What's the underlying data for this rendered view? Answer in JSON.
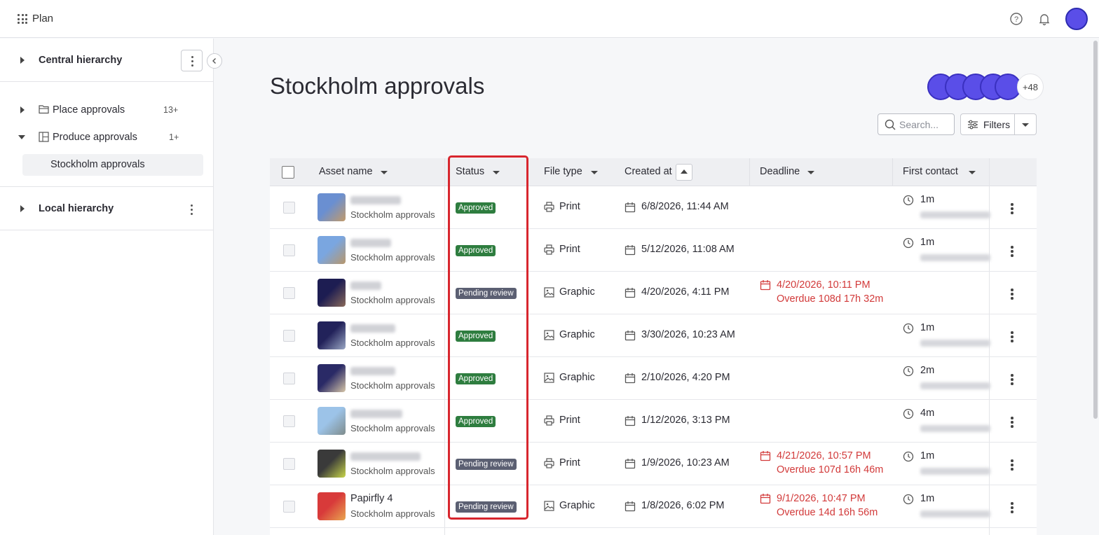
{
  "app": {
    "title": "Plan"
  },
  "sidebar": {
    "central": {
      "label": "Central hierarchy"
    },
    "place": {
      "label": "Place approvals",
      "count": "13+"
    },
    "produce": {
      "label": "Produce approvals",
      "count": "1+"
    },
    "selected": {
      "label": "Stockholm approvals"
    },
    "local": {
      "label": "Local hierarchy"
    }
  },
  "main": {
    "title": "Stockholm approvals",
    "avatars_more": "+48",
    "search_placeholder": "Search...",
    "filters_label": "Filters"
  },
  "table": {
    "headers": [
      "Asset name",
      "Status",
      "File type",
      "Created at",
      "Deadline",
      "First contact"
    ],
    "rows": [
      {
        "name": "",
        "sub": "Stockholm approvals",
        "status": "Approved",
        "status_kind": "approved",
        "filetype": "Print",
        "created": "6/8/2026, 11:44 AM",
        "deadline": "",
        "overdue": "",
        "first_contact": "1m",
        "thumb": [
          "#6a8fd1",
          "#c29a6a"
        ]
      },
      {
        "name": "",
        "sub": "Stockholm approvals",
        "status": "Approved",
        "status_kind": "approved",
        "filetype": "Print",
        "created": "5/12/2026, 11:08 AM",
        "deadline": "",
        "overdue": "",
        "first_contact": "1m",
        "thumb": [
          "#7aa6e0",
          "#b8976b"
        ]
      },
      {
        "name": "",
        "sub": "Stockholm approvals",
        "status": "Pending review",
        "status_kind": "pending",
        "filetype": "Graphic",
        "created": "4/20/2026, 4:11 PM",
        "deadline": "4/20/2026, 10:11 PM",
        "overdue": "Overdue 108d 17h 32m",
        "first_contact": "",
        "thumb": [
          "#1d1d52",
          "#8a6a5a"
        ]
      },
      {
        "name": "",
        "sub": "Stockholm approvals",
        "status": "Approved",
        "status_kind": "approved",
        "filetype": "Graphic",
        "created": "3/30/2026, 10:23 AM",
        "deadline": "",
        "overdue": "",
        "first_contact": "1m",
        "thumb": [
          "#22225a",
          "#9aa7c4"
        ]
      },
      {
        "name": "",
        "sub": "Stockholm approvals",
        "status": "Approved",
        "status_kind": "approved",
        "filetype": "Graphic",
        "created": "2/10/2026, 4:20 PM",
        "deadline": "",
        "overdue": "",
        "first_contact": "2m",
        "thumb": [
          "#2a2a66",
          "#d7c6a8"
        ]
      },
      {
        "name": "",
        "sub": "Stockholm approvals",
        "status": "Approved",
        "status_kind": "approved",
        "filetype": "Print",
        "created": "1/12/2026, 3:13 PM",
        "deadline": "",
        "overdue": "",
        "first_contact": "4m",
        "thumb": [
          "#9cc3e8",
          "#7f8c8c"
        ]
      },
      {
        "name": "",
        "sub": "Stockholm approvals",
        "status": "Pending review",
        "status_kind": "pending",
        "filetype": "Print",
        "created": "1/9/2026, 10:23 AM",
        "deadline": "4/21/2026, 10:57 PM",
        "overdue": "Overdue 107d 16h 46m",
        "first_contact": "1m",
        "thumb": [
          "#3a3a3a",
          "#c8d64a"
        ]
      },
      {
        "name": "Papirfly 4",
        "sub": "Stockholm approvals",
        "status": "Pending review",
        "status_kind": "pending",
        "filetype": "Graphic",
        "created": "1/8/2026, 6:02 PM",
        "deadline": "9/1/2026, 10:47 PM",
        "overdue": "Overdue 14d 16h 56m",
        "first_contact": "1m",
        "thumb": [
          "#d83a3a",
          "#e9a650"
        ]
      }
    ]
  },
  "colors": {
    "accent": "#5a4ee8",
    "approved": "#2e7d3f",
    "pending": "#5b5f72",
    "overdue": "#d23a3a",
    "highlight": "#d8262e"
  }
}
